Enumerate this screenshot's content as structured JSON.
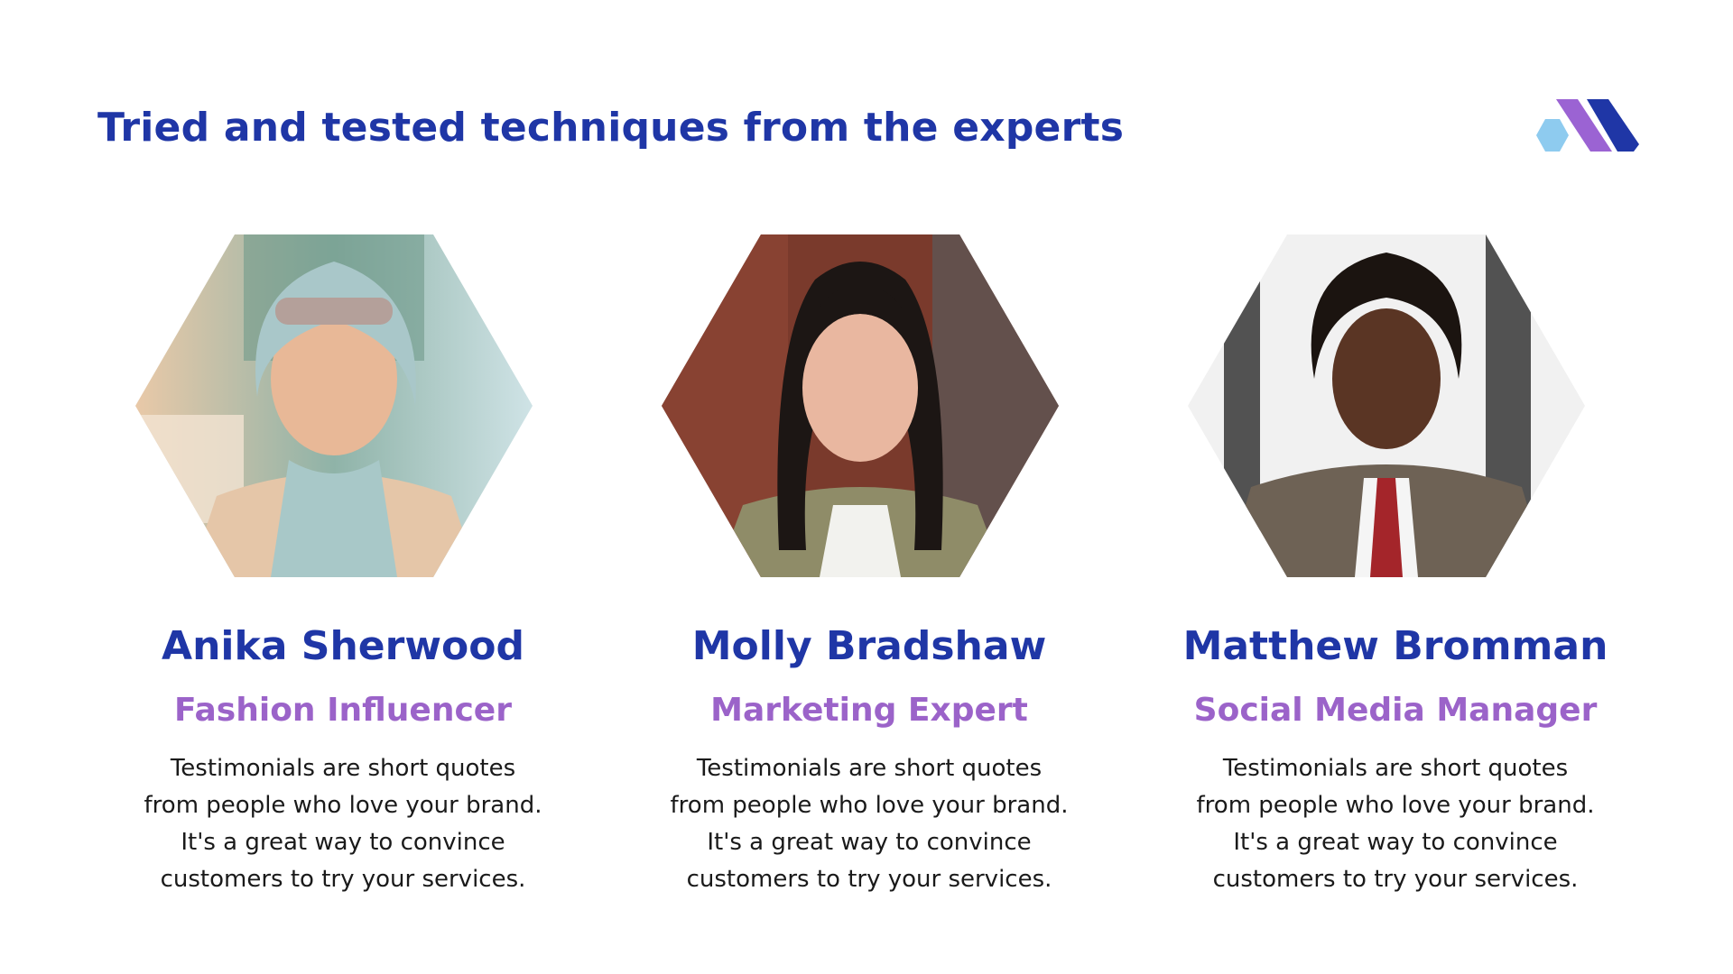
{
  "colors": {
    "title": "#1f36a6",
    "name": "#1f36a6",
    "role": "#9b63c9",
    "text": "#1a1a1a",
    "logo_light": "#8ecbef",
    "logo_purple": "#9b63d3",
    "logo_blue": "#1f36a6"
  },
  "title": "Tried and tested techniques from the experts",
  "logo": {
    "icon": "brand-logo-icon"
  },
  "testimonials": [
    {
      "name": "Anika Sherwood",
      "role": "Fashion Influencer",
      "quote_lines": [
        "Testimonials are short quotes",
        "from people who love your brand.",
        "It's a great way to convince",
        "customers to try your services."
      ],
      "photo_icon": "portrait-photo"
    },
    {
      "name": "Molly Bradshaw",
      "role": "Marketing Expert",
      "quote_lines": [
        "Testimonials are short quotes",
        "from people who love your brand.",
        "It's a great way to convince",
        "customers to try your services."
      ],
      "photo_icon": "portrait-photo"
    },
    {
      "name": "Matthew Bromman",
      "role": "Social Media Manager",
      "quote_lines": [
        "Testimonials are short quotes",
        "from people who love your brand.",
        "It's a great way to convince",
        "customers to try your services."
      ],
      "photo_icon": "portrait-photo"
    }
  ]
}
